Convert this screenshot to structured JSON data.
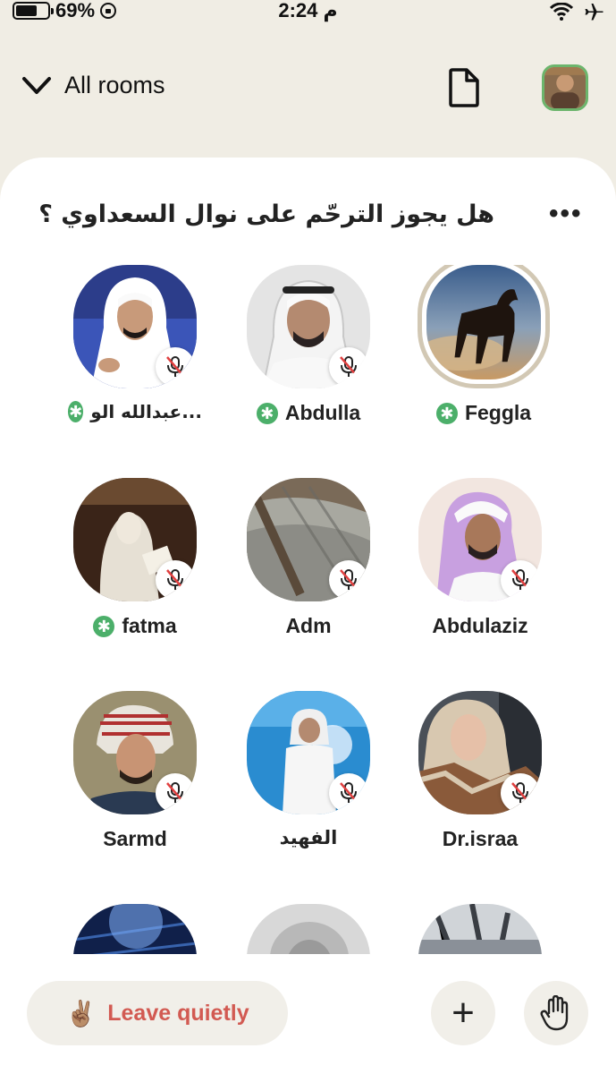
{
  "status_bar": {
    "battery": "69%",
    "battery_level": 0.69,
    "time": "2:24 م"
  },
  "header": {
    "rooms_label": "All rooms"
  },
  "room": {
    "title": "هل يجوز الترحّم على نوال السعداوي ؟",
    "more": "•••"
  },
  "speakers": [
    {
      "name": "Feggla",
      "moderator": true,
      "muted": false,
      "ring": true
    },
    {
      "name": "Abdulla",
      "moderator": true,
      "muted": true
    },
    {
      "name": "عبدالله الو...",
      "moderator": true,
      "muted": true
    },
    {
      "name": "Abdulaziz",
      "moderator": false,
      "muted": true
    },
    {
      "name": "Adm",
      "moderator": false,
      "muted": true
    },
    {
      "name": "fatma",
      "moderator": true,
      "muted": true
    },
    {
      "name": "Dr.israa",
      "moderator": false,
      "muted": true
    },
    {
      "name": "الفهيد",
      "moderator": false,
      "muted": true
    },
    {
      "name": "Sarmd",
      "moderator": false,
      "muted": true
    }
  ],
  "footer": {
    "leave_label": "Leave quietly",
    "leave_emoji": "✌🏽",
    "plus": "+"
  },
  "colors": {
    "background": "#f0ede4",
    "card": "#ffffff",
    "leave_text": "#d25a52",
    "moderator_badge": "#4caf6a",
    "ring": "#d2c8b4"
  }
}
